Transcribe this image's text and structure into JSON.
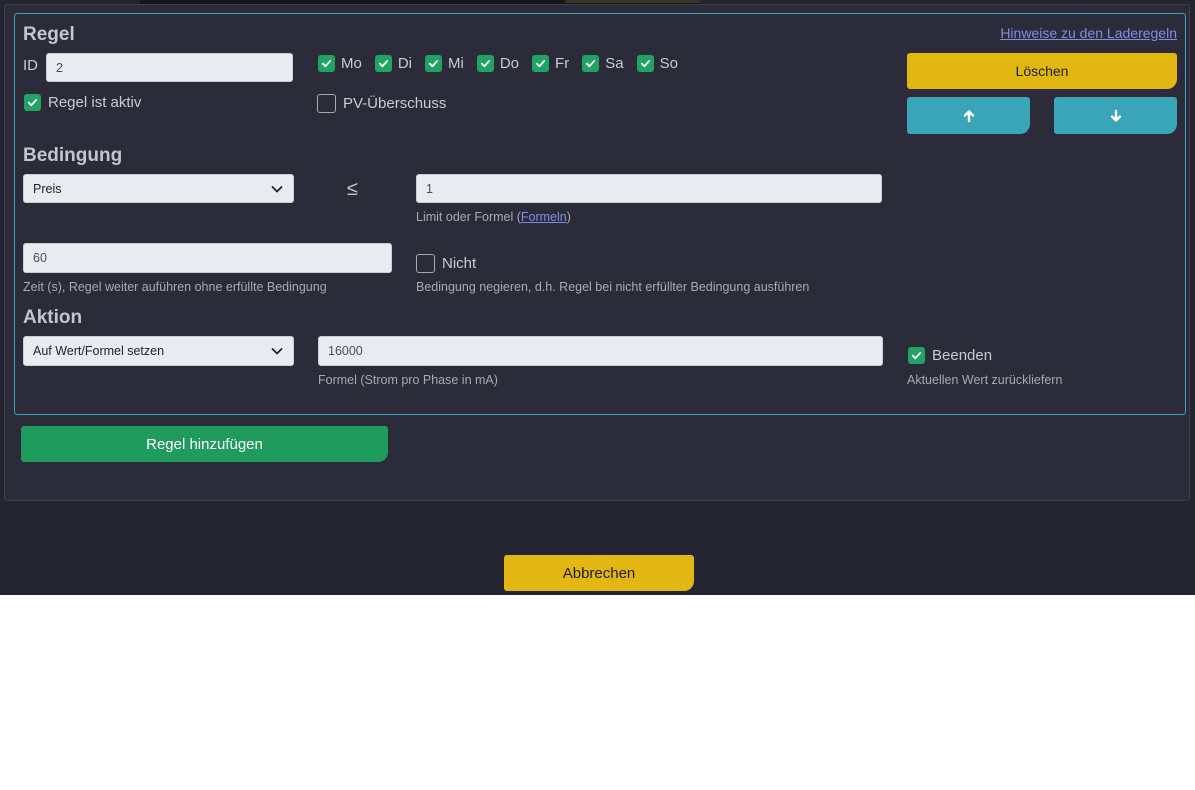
{
  "rule": {
    "title": "Regel",
    "hint_link": "Hinweise zu den Laderegeln",
    "id_label": "ID",
    "id_value": "2",
    "days": [
      {
        "label": "Mo",
        "checked": true
      },
      {
        "label": "Di",
        "checked": true
      },
      {
        "label": "Mi",
        "checked": true
      },
      {
        "label": "Do",
        "checked": true
      },
      {
        "label": "Fr",
        "checked": true
      },
      {
        "label": "Sa",
        "checked": true
      },
      {
        "label": "So",
        "checked": true
      }
    ],
    "active_label": "Regel ist aktiv",
    "active_checked": true,
    "pv_label": "PV-Überschuss",
    "pv_checked": false,
    "delete_label": "Löschen",
    "move_up_icon": "arrow-up-icon",
    "move_down_icon": "arrow-down-icon"
  },
  "condition": {
    "title": "Bedingung",
    "select_value": "Preis",
    "operator": "≤",
    "limit_value": "1",
    "limit_hint_prefix": "Limit oder Formel (",
    "limit_hint_link": "Formeln",
    "limit_hint_suffix": ")",
    "time_value": "60",
    "time_hint": "Zeit (s), Regel weiter auführen ohne erfüllte Bedingung",
    "negate_label": "Nicht",
    "negate_checked": false,
    "negate_hint": "Bedingung negieren, d.h. Regel bei nicht erfüllter Bedingung ausführen"
  },
  "action": {
    "title": "Aktion",
    "select_value": "Auf Wert/Formel setzen",
    "formula_value": "16000",
    "formula_hint": "Formel (Strom pro Phase in mA)",
    "stop_label": "Beenden",
    "stop_checked": true,
    "stop_hint": "Aktuellen Wert zurückliefern"
  },
  "footer": {
    "add_rule_label": "Regel hinzufügen",
    "cancel_label": "Abbrechen"
  },
  "colors": {
    "accent_teal": "#3aa4b8",
    "accent_yellow": "#e2b714",
    "accent_green": "#209b5e",
    "checkbox_green": "#21a363",
    "panel_bg": "#2c2b39",
    "page_bg": "#242530"
  }
}
